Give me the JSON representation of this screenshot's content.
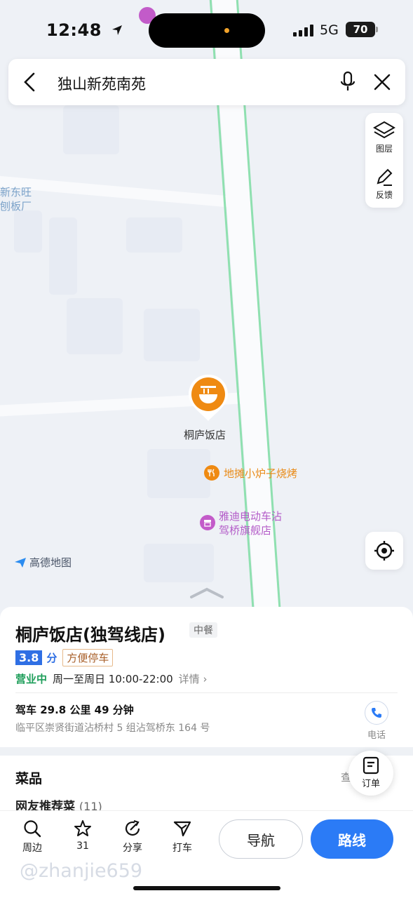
{
  "status_bar": {
    "time": "12:48",
    "network": "5G",
    "battery": "70"
  },
  "search": {
    "query": "独山新苑南苑"
  },
  "side_tools": {
    "layers_label": "图层",
    "feedback_label": "反馈"
  },
  "map": {
    "labels": {
      "factory_line1": "新东旺",
      "factory_line2": "刨板厂",
      "selected_pin_label": "桐庐饭店",
      "bbq_poi": "地摊小炉子烧烤",
      "store_poi_line1": "雅迪电动车沾",
      "store_poi_line2": "驾桥旗舰店"
    },
    "brand": "高德地图"
  },
  "place": {
    "name": "桐庐饭店(独驾线店)",
    "category": "中餐",
    "rating": "3.8",
    "rating_unit": "分",
    "tag": "方便停车",
    "status": "营业中",
    "hours": "周一至周日 10:00-22:00",
    "detail_link": "详情",
    "drive_info": "驾车 29.8 公里 49 分钟",
    "address": "临平区崇贤街道沾桥村 5 组沾驾桥东 164 号",
    "call_label": "电话"
  },
  "menu": {
    "title": "菜品",
    "more": "查",
    "recommend_label": "网友推荐菜",
    "recommend_count": "(11)",
    "order_label": "订单"
  },
  "bottom_bar": {
    "nearby": "周边",
    "favorite_count": "31",
    "share": "分享",
    "taxi": "打车",
    "navigate": "导航",
    "route": "路线",
    "watermark": "@zhanjie659"
  }
}
